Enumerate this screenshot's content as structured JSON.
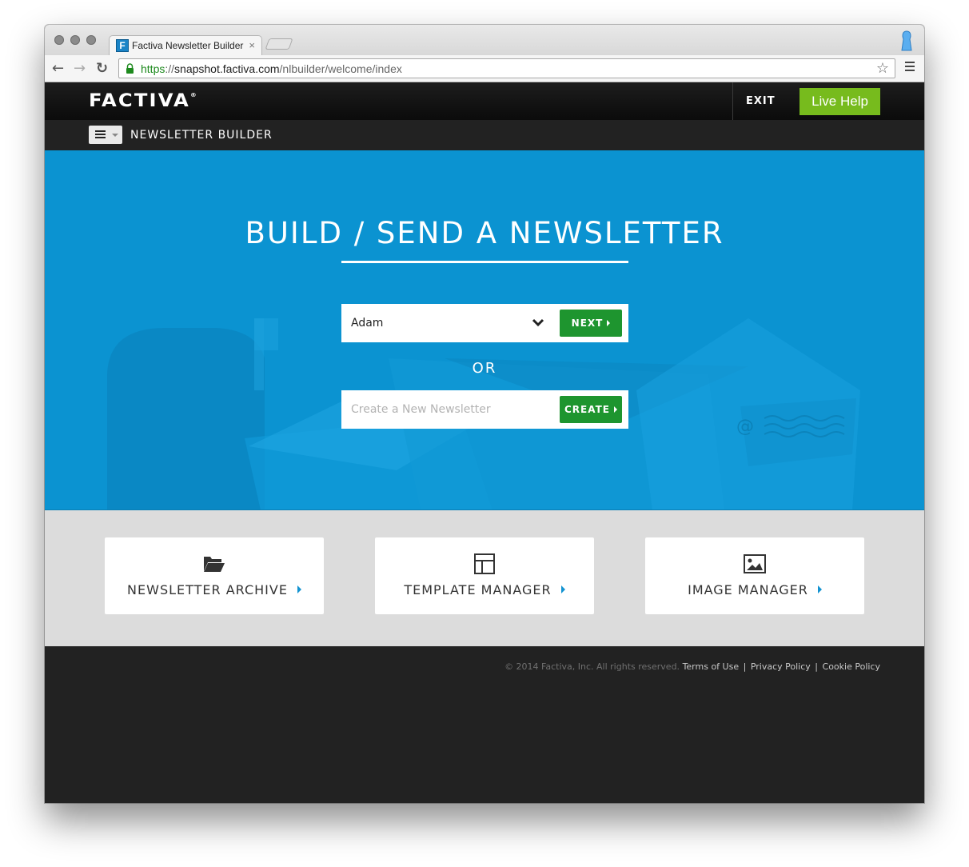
{
  "browser": {
    "tab_title": "Factiva Newsletter Builder",
    "tab_close": "×",
    "favicon_letter": "F",
    "url_scheme": "https",
    "url_host": "snapshot.factiva.com",
    "url_path": "/nlbuilder/welcome/index",
    "back": "←",
    "forward": "→",
    "reload": "↻",
    "star": "☆"
  },
  "header": {
    "logo": "FACTIVA",
    "logo_mark": "®",
    "exit_label": "EXIT",
    "live_help_label": "Live Help",
    "live_help_color": "#77bb1d"
  },
  "subheader": {
    "title": "NEWSLETTER BUILDER"
  },
  "hero": {
    "title": "BUILD / SEND A NEWSLETTER",
    "background_color": "#0b93d1",
    "newsletter_select": {
      "selected": "Adam"
    },
    "next_label": "NEXT",
    "or_label": "OR",
    "create_placeholder": "Create a New Newsletter",
    "create_value": "",
    "create_label": "CREATE",
    "button_color": "#1e952f"
  },
  "cards": [
    {
      "label": "NEWSLETTER ARCHIVE",
      "icon": "folder-open-icon"
    },
    {
      "label": "TEMPLATE MANAGER",
      "icon": "layout-icon"
    },
    {
      "label": "IMAGE MANAGER",
      "icon": "image-icon"
    }
  ],
  "footer": {
    "copyright": "© 2014 Factiva, Inc. All rights reserved.",
    "links": [
      "Terms of Use",
      "Privacy Policy",
      "Cookie Policy"
    ],
    "separator": "|"
  }
}
